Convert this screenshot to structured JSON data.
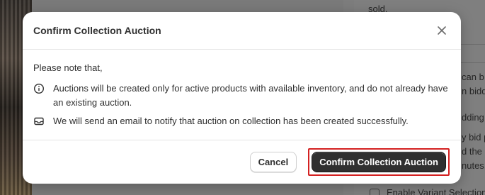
{
  "background": {
    "right_panel": {
      "lines": [
        "sold.",
        "can b",
        "n biddi",
        "dding",
        "y bid p",
        "d the a",
        "nutes.",
        "Enable Variant Selection"
      ]
    }
  },
  "modal": {
    "title": "Confirm Collection Auction",
    "intro": "Please note that,",
    "notes": [
      {
        "icon": "info-icon",
        "text": "Auctions will be created only for active products with available inventory, and do not already have an existing auction."
      },
      {
        "icon": "envelope-icon",
        "text": "We will send an email to notify that auction on collection has been created successfully."
      }
    ],
    "cancel_label": "Cancel",
    "confirm_label": "Confirm Collection Auction"
  },
  "colors": {
    "primary_button": "#303030",
    "highlight_border": "#d42121"
  }
}
